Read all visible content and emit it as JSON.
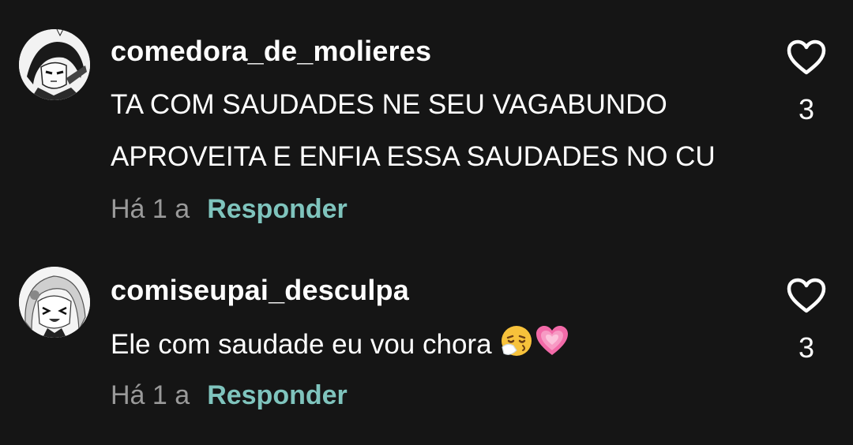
{
  "comments": [
    {
      "username": "comedora_de_molieres",
      "lines": [
        "TA COM SAUDADES NE SEU VAGABUNDO",
        "APROVEITA E ENFIA ESSA SAUDADES NO CU"
      ],
      "time": "Há 1 a",
      "reply_label": "Responder",
      "like_count": "3",
      "avatar_icon": "anime-boy-avatar"
    },
    {
      "username": "comiseupai_desculpa",
      "text": "Ele com saudade eu vou chora",
      "emojis": [
        "sneezing-face",
        "growing-heart"
      ],
      "time": "Há 1 a",
      "reply_label": "Responder",
      "like_count": "3",
      "avatar_icon": "anime-girl-avatar"
    }
  ],
  "colors": {
    "background": "#151515",
    "text": "#ffffff",
    "muted": "#9a9a9a",
    "reply": "#7fc4bd"
  }
}
